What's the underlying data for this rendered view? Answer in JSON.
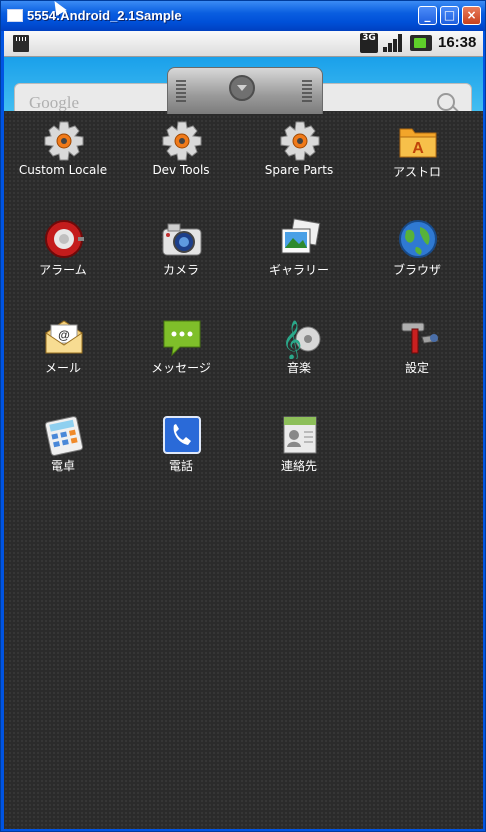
{
  "window": {
    "title": "5554:Android_2.1Sample",
    "minimize_label": "_",
    "maximize_label": "□",
    "close_label": "×"
  },
  "statusbar": {
    "network_badge": "3G",
    "time": "16:38",
    "battery_color": "#5fcf2a"
  },
  "search": {
    "placeholder": "Google"
  },
  "apps": [
    {
      "label": "Custom Locale",
      "icon": "gear-icon"
    },
    {
      "label": "Dev Tools",
      "icon": "gear-icon"
    },
    {
      "label": "Spare Parts",
      "icon": "gear-icon"
    },
    {
      "label": "アストロ",
      "icon": "folder-icon"
    },
    {
      "label": "アラーム",
      "icon": "alarm-icon"
    },
    {
      "label": "カメラ",
      "icon": "camera-icon"
    },
    {
      "label": "ギャラリー",
      "icon": "gallery-icon"
    },
    {
      "label": "ブラウザ",
      "icon": "globe-icon"
    },
    {
      "label": "メール",
      "icon": "mail-icon"
    },
    {
      "label": "メッセージ",
      "icon": "message-icon"
    },
    {
      "label": "音楽",
      "icon": "music-icon"
    },
    {
      "label": "設定",
      "icon": "settings-tools-icon"
    },
    {
      "label": "電卓",
      "icon": "calculator-icon"
    },
    {
      "label": "電話",
      "icon": "phone-icon"
    },
    {
      "label": "連絡先",
      "icon": "contacts-icon"
    }
  ]
}
